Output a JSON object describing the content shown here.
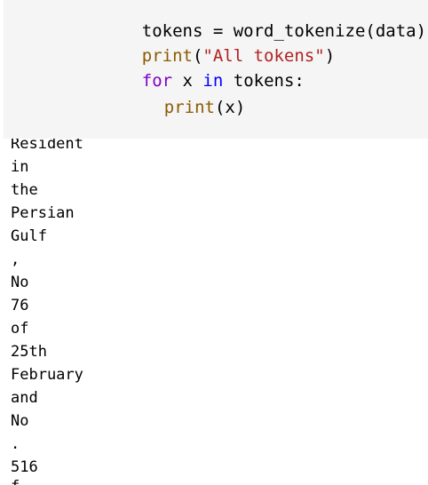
{
  "code": {
    "line1": {
      "a": "tokens = word_tokenize(data)"
    },
    "line2": {
      "fn": "print",
      "open": "(",
      "str": "\"All tokens\"",
      "close": ")"
    },
    "line3": {
      "kw": "for",
      "mid": " x ",
      "kw2": "in",
      "tail": " tokens:"
    },
    "line4": {
      "fn": "print",
      "rest": "(x)"
    }
  },
  "output": {
    "lines": [
      "Resident",
      "in",
      "the",
      "Persian",
      "Gulf",
      ",",
      "No",
      "76",
      "of",
      "25th",
      "February",
      "and",
      "No",
      ".",
      "516",
      "f"
    ]
  },
  "colors": {
    "keyword": "#7f00c8",
    "builtin": "#8b5a00",
    "string": "#b22222",
    "keyword_in": "#0000ff",
    "cell_background": "#f5f5f5"
  }
}
